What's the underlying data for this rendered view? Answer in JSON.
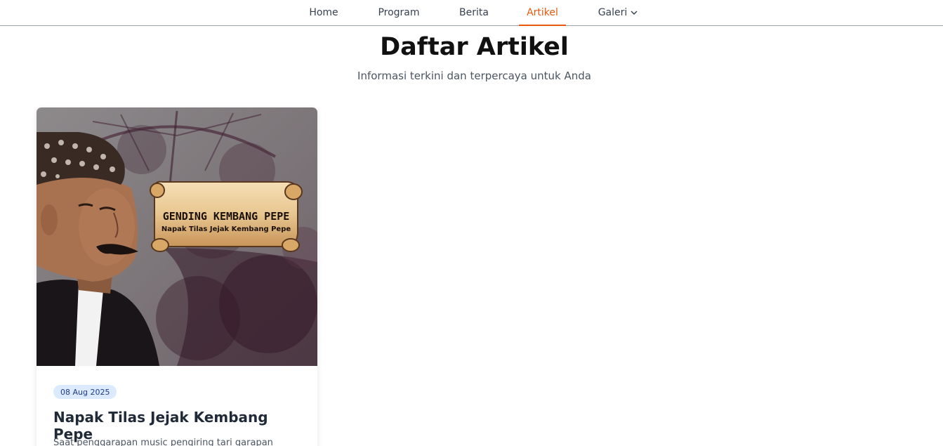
{
  "nav": {
    "items": [
      {
        "label": "Home"
      },
      {
        "label": "Program"
      },
      {
        "label": "Berita"
      },
      {
        "label": "Artikel",
        "active": true
      },
      {
        "label": "Galeri",
        "has_dropdown": true
      }
    ],
    "active_color": "#ea580c"
  },
  "header": {
    "title": "Daftar Artikel",
    "subtitle": "Informasi terkini dan terpercaya untuk Anda"
  },
  "articles": [
    {
      "image": {
        "banner_title": "GENDING KEMBANG PEPE",
        "banner_subtitle": "Napak Tilas Jejak Kembang Pepe"
      },
      "date": "08 Aug 2025",
      "title": "Napak Tilas Jejak Kembang Pepe",
      "excerpt": "Saat penggarapan music pengiring tari garapan"
    }
  ],
  "colors": {
    "badge_bg": "#dbeafe",
    "badge_text": "#1e3a8a"
  }
}
